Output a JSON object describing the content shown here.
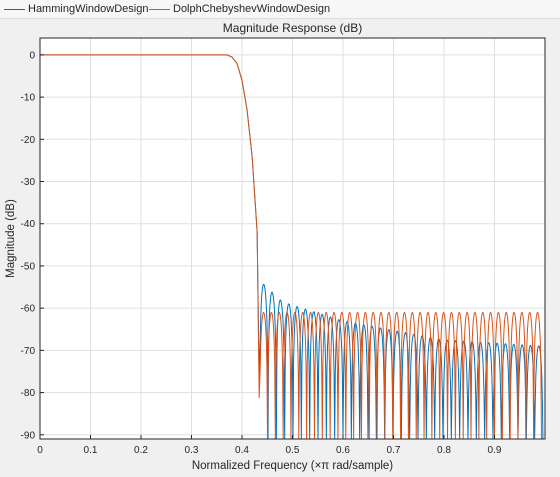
{
  "colors": {
    "hamming": "#0072bd",
    "chebyshev": "#d95319",
    "grid": "#dfdfdf",
    "axes_bg": "#ffffff",
    "page_bg": "#f0f0f0",
    "tick_text": "#262626"
  },
  "legend": {
    "placement": "top",
    "items": [
      {
        "label": "HammingWindowDesign",
        "color": "#0072bd"
      },
      {
        "label": "DolphChebyshevWindowDesign",
        "color": "#d95319"
      }
    ]
  },
  "chart_data": {
    "type": "line",
    "title": "Magnitude Response (dB)",
    "xlabel": "Normalized Frequency (×π rad/sample)",
    "ylabel": "Magnitude (dB)",
    "xlim": [
      0,
      1
    ],
    "ylim": [
      -91,
      4
    ],
    "grid": true,
    "x_ticks": [
      0,
      0.1,
      0.2,
      0.3,
      0.4,
      0.5,
      0.6,
      0.7,
      0.8,
      0.9
    ],
    "x_tick_labels": [
      "0",
      "0.1",
      "0.2",
      "0.3",
      "0.4",
      "0.5",
      "0.6",
      "0.7",
      "0.8",
      "0.9"
    ],
    "y_ticks": [
      0,
      -10,
      -20,
      -30,
      -40,
      -50,
      -60,
      -70,
      -80,
      -90
    ],
    "y_tick_labels": [
      "0",
      "-10",
      "-20",
      "-30",
      "-40",
      "-50",
      "-60",
      "-70",
      "-80",
      "-90"
    ],
    "series": [
      {
        "name": "HammingWindowDesign",
        "color": "#0072bd",
        "passband_db": 0,
        "rolloff": [
          [
            0.37,
            0
          ],
          [
            0.38,
            -0.5
          ],
          [
            0.39,
            -2
          ],
          [
            0.4,
            -6
          ],
          [
            0.41,
            -13
          ],
          [
            0.42,
            -24
          ],
          [
            0.43,
            -42
          ],
          [
            0.435,
            -85
          ]
        ],
        "sidelobe_start": 0.44,
        "sidelobe_spacing": 0.0165,
        "sidelobe_peaks": [
          [
            0.44,
            -54
          ],
          [
            0.48,
            -58.5
          ],
          [
            0.6,
            -63
          ],
          [
            0.8,
            -67.5
          ],
          [
            1.0,
            -69
          ]
        ]
      },
      {
        "name": "DolphChebyshevWindowDesign",
        "color": "#d95319",
        "passband_db": 0,
        "rolloff": [
          [
            0.37,
            0
          ],
          [
            0.38,
            -0.5
          ],
          [
            0.39,
            -2
          ],
          [
            0.4,
            -6
          ],
          [
            0.41,
            -13
          ],
          [
            0.42,
            -24
          ],
          [
            0.43,
            -42
          ],
          [
            0.435,
            -91
          ]
        ],
        "sidelobe_start": 0.44,
        "sidelobe_spacing": 0.0155,
        "sidelobe_peaks": [
          [
            0.44,
            -61
          ],
          [
            1.0,
            -61
          ]
        ]
      }
    ]
  }
}
